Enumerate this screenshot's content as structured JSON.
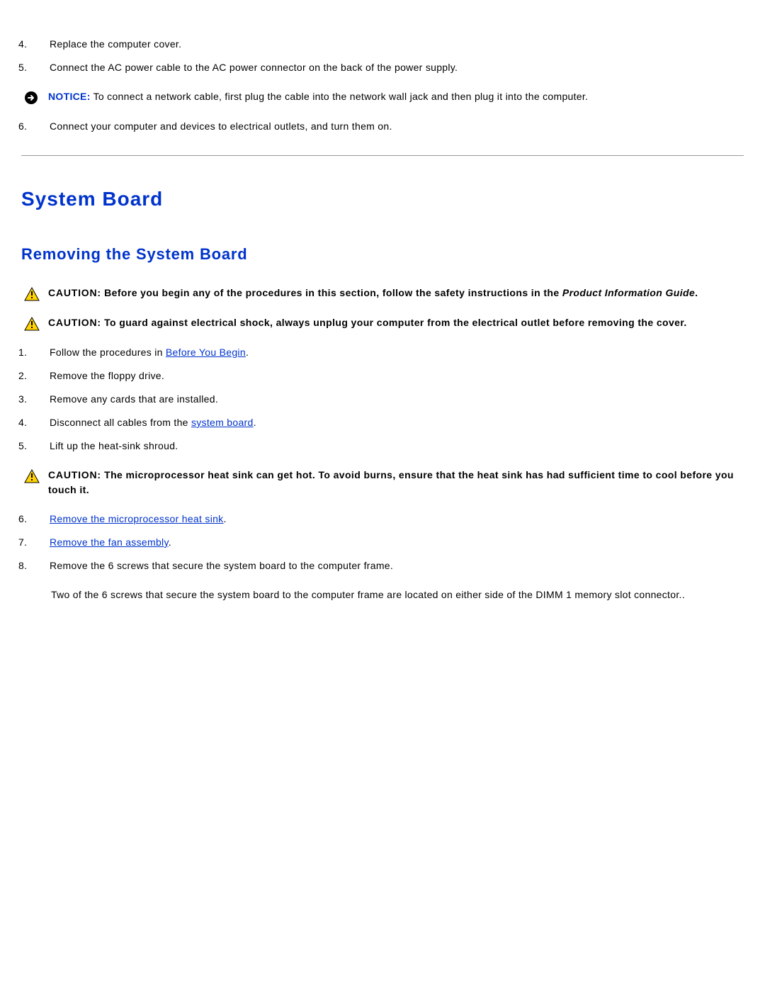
{
  "top_steps": [
    {
      "num": "4.",
      "text": "Replace the computer cover."
    },
    {
      "num": "5.",
      "text": "Connect the AC power cable to the AC power connector on the back of the power supply."
    }
  ],
  "notice": {
    "label": "NOTICE:",
    "text": " To connect a network cable, first plug the cable into the network wall jack and then plug it into the computer."
  },
  "top_steps_2": [
    {
      "num": "6.",
      "text": "Connect your computer and devices to electrical outlets, and turn them on."
    }
  ],
  "section_title": "System Board",
  "subsection_title": "Removing the System Board",
  "cautions": [
    {
      "label": "CAUTION:",
      "text_before_italic": " Before you begin any of the procedures in this section, follow the safety instructions in the ",
      "italic_text": "Product Information Guide",
      "text_after_italic": "."
    },
    {
      "label": "CAUTION:",
      "text_before_italic": " To guard against electrical shock, always unplug your computer from the electrical outlet before removing the cover.",
      "italic_text": "",
      "text_after_italic": ""
    }
  ],
  "mid_steps": [
    {
      "num": "1.",
      "prefix": "Follow the procedures in ",
      "link": "Before You Begin",
      "suffix": "."
    },
    {
      "num": "2.",
      "prefix": "Remove the floppy drive.",
      "link": "",
      "suffix": ""
    },
    {
      "num": "3.",
      "prefix": "Remove any cards that are installed.",
      "link": "",
      "suffix": ""
    },
    {
      "num": "4.",
      "prefix": "Disconnect all cables from the ",
      "link": "system board",
      "suffix": "."
    },
    {
      "num": "5.",
      "prefix": "Lift up the heat-sink shroud.",
      "link": "",
      "suffix": ""
    }
  ],
  "caution3": {
    "label": "CAUTION:",
    "text": " The microprocessor heat sink can get hot. To avoid burns, ensure that the heat sink has had sufficient time to cool before you touch it."
  },
  "end_steps": [
    {
      "num": "6.",
      "prefix": "",
      "link": "Remove the microprocessor heat sink",
      "suffix": "."
    },
    {
      "num": "7.",
      "prefix": "",
      "link": "Remove the fan assembly",
      "suffix": "."
    },
    {
      "num": "8.",
      "prefix": "Remove the 6 screws that secure the system board to the computer frame.",
      "link": "",
      "suffix": ""
    }
  ],
  "note_text": "Two of the 6 screws that secure the system board to the computer frame are located on either side of the DIMM 1 memory slot connector.."
}
